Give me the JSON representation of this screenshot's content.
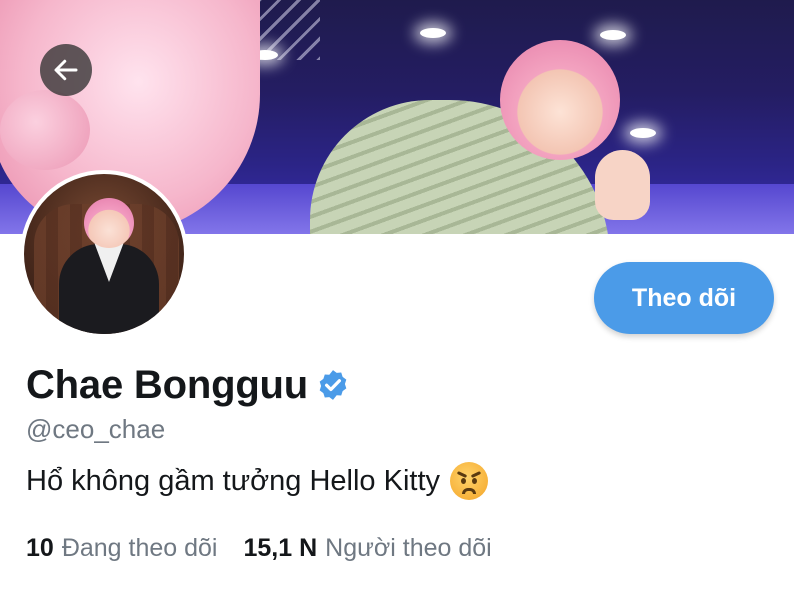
{
  "profile": {
    "display_name": "Chae Bongguu",
    "handle": "@ceo_chae",
    "bio": "Hổ không gầm tưởng Hello Kitty",
    "verified": true,
    "bio_emoji": "angry-face-emoji"
  },
  "actions": {
    "follow_label": "Theo dõi",
    "back_icon": "arrow-left-icon"
  },
  "stats": {
    "following_count": "10",
    "following_label": "Đang theo dõi",
    "followers_count": "15,1 N",
    "followers_label": "Người theo dõi"
  },
  "colors": {
    "accent": "#4b9be8",
    "verified": "#4b9be8",
    "secondary_text": "#6f7882",
    "primary_text": "#14171a"
  }
}
